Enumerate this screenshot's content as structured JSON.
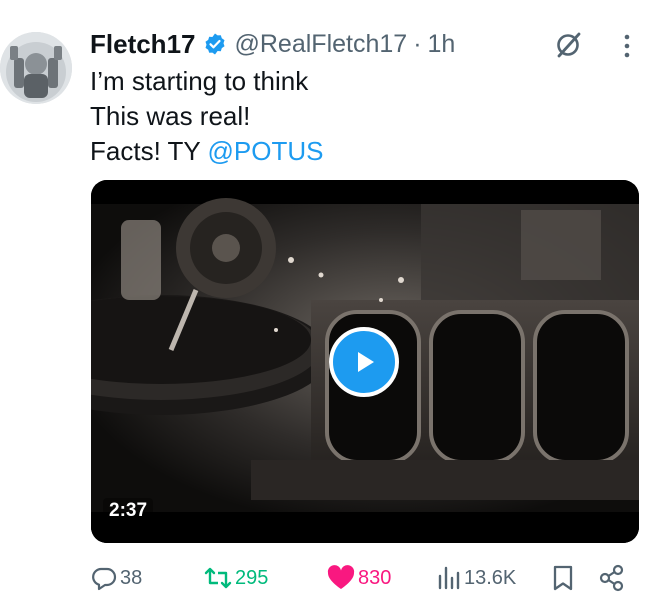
{
  "author": {
    "display_name": "Fletch17",
    "handle": "@RealFletch17",
    "separator": "·",
    "time": "1h",
    "verified": true
  },
  "tweet": {
    "line1": "I’m starting to think",
    "line2": "This was real!",
    "line3_prefix": "Facts! TY ",
    "mention": "@POTUS"
  },
  "video": {
    "duration": "2:37"
  },
  "actions": {
    "replies": "38",
    "reposts": "295",
    "likes": "830",
    "views": "13.6K"
  },
  "colors": {
    "accent": "#1d9bf0",
    "repost": "#00ba7c",
    "like": "#f91880",
    "muted": "#536471"
  },
  "icons": {
    "verified": "verified-badge-icon",
    "grok": "grok-icon",
    "more": "more-vertical-icon",
    "play": "play-icon",
    "reply": "reply-icon",
    "repost": "repost-icon",
    "like": "heart-icon",
    "views": "views-icon",
    "bookmark": "bookmark-icon",
    "share": "share-icon"
  }
}
